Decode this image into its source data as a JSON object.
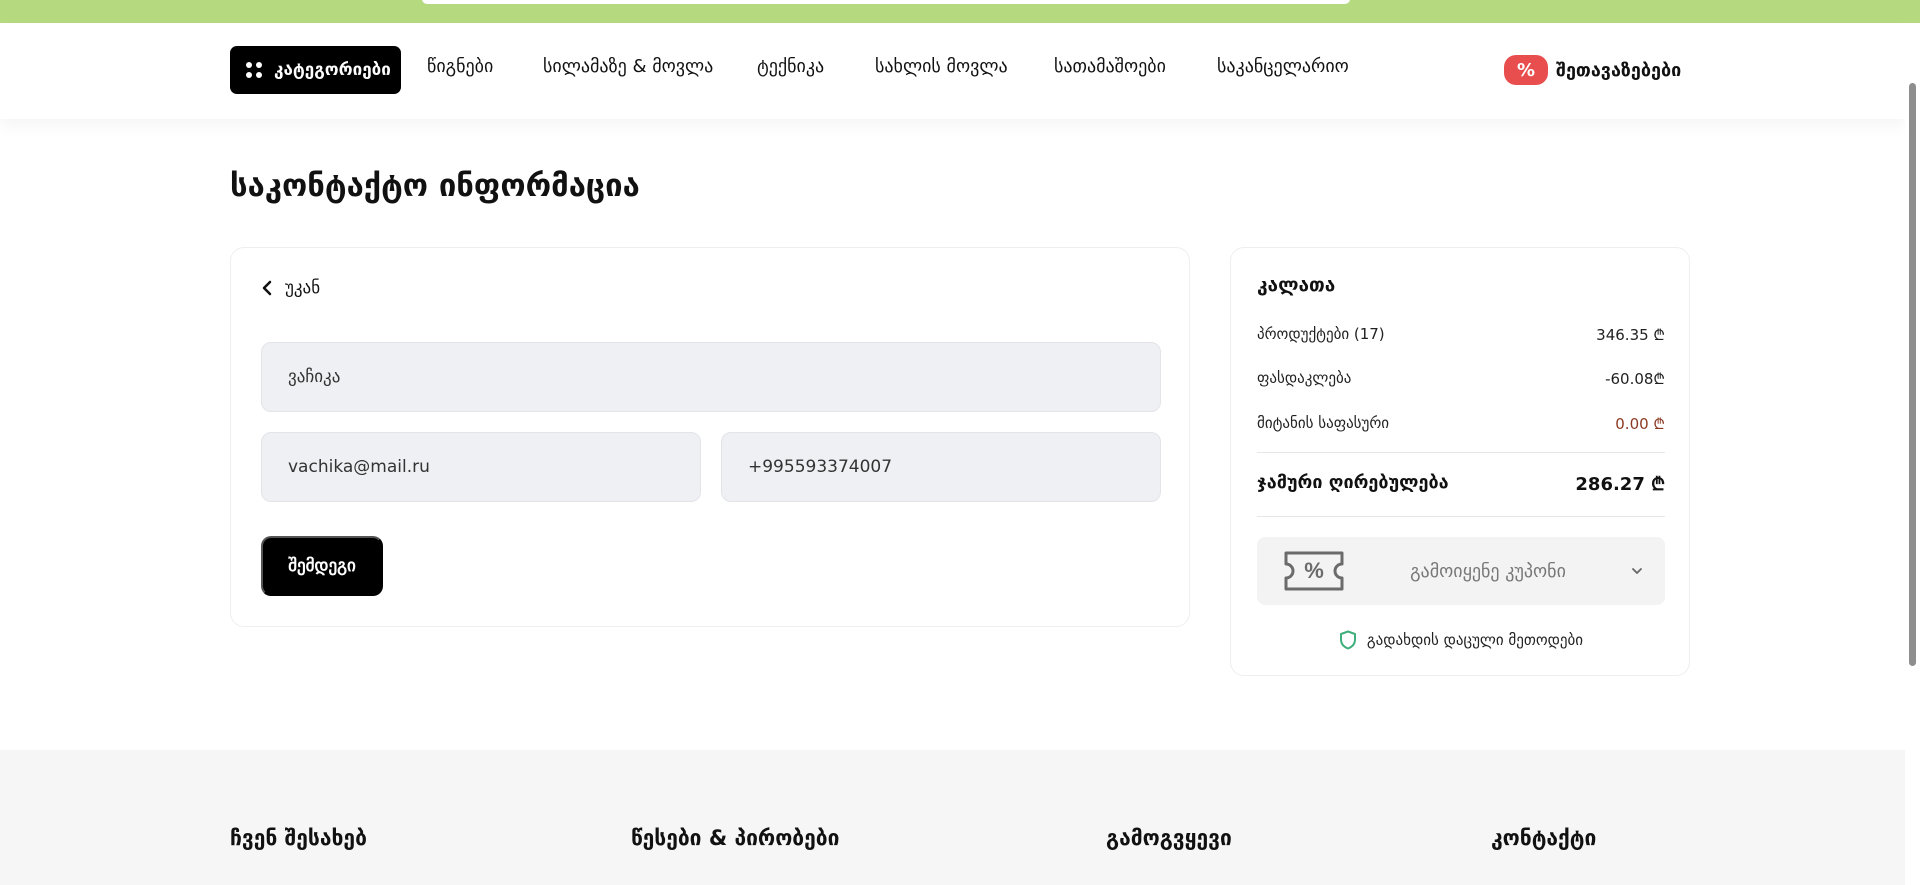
{
  "nav": {
    "categories_label": "კატეგორიები",
    "items": [
      "წიგნები",
      "სილამაზე & მოვლა",
      "ტექნიკა",
      "სახლის მოვლა",
      "სათამაშოები",
      "საკანცელარიო"
    ],
    "offers_badge": "%",
    "offers_label": "შეთავაზებები"
  },
  "page": {
    "title": "საკონტაქტო ინფორმაცია"
  },
  "form": {
    "back_label": "უკან",
    "name_value": "ვაჩიკა",
    "email_value": "vachika@mail.ru",
    "phone_value": "+995593374007",
    "next_label": "შემდეგი"
  },
  "cart": {
    "title": "კალათა",
    "products_label": "პროდუქტები (17)",
    "products_value": "346.35 ₾",
    "discount_label": "ფასდაკლება",
    "discount_value": "-60.08₾",
    "delivery_label": "მიტანის საფასური",
    "delivery_value": "0.00 ₾",
    "total_label": "ჯამური ღირებულება",
    "total_value": "286.27 ₾",
    "coupon_label": "გამოიყენე კუპონი",
    "coupon_icon_text": "%",
    "secure_label": "გადახდის დაცული მეთოდები"
  },
  "footer": {
    "about": "ჩვენ შესახებ",
    "terms": "წესები & პირობები",
    "subscribe": "გამოგვყევი",
    "contact": "კონტაქტი"
  },
  "colors": {
    "accent_green": "#b5d97f",
    "offers_red": "#e94e4e",
    "delivery_value": "#8a3a22",
    "secure_shield": "#3fae7a"
  },
  "icons": [
    "grid-dots-icon",
    "percent-badge-icon",
    "chevron-left-icon",
    "coupon-ticket-icon",
    "chevron-down-icon",
    "shield-icon"
  ]
}
